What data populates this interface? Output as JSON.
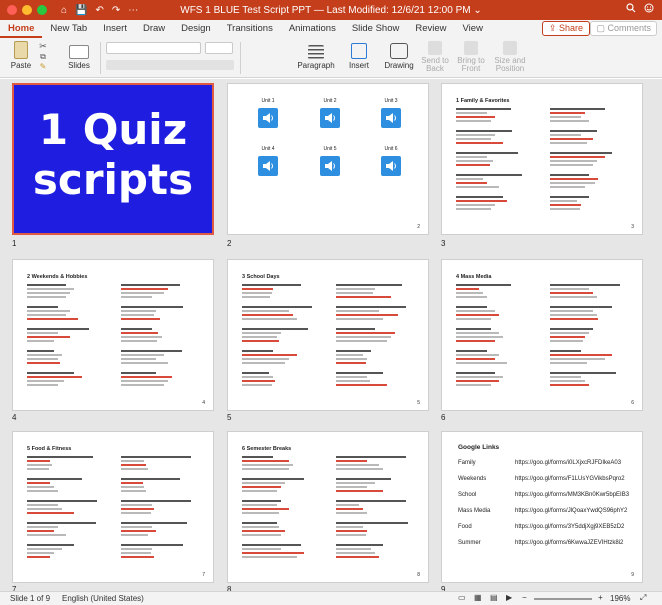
{
  "app": {
    "title": "WFS 1 BLUE Test Script PPT",
    "modified": "— Last Modified: 12/6/21 12:00 PM",
    "title_chevron": "⌄"
  },
  "quick_access": [
    "⌂",
    "💾",
    "↶",
    "↷",
    "⋯"
  ],
  "tabs": [
    {
      "label": "Home",
      "active": true
    },
    {
      "label": "New Tab"
    },
    {
      "label": "Insert"
    },
    {
      "label": "Draw"
    },
    {
      "label": "Design"
    },
    {
      "label": "Transitions"
    },
    {
      "label": "Animations"
    },
    {
      "label": "Slide Show"
    },
    {
      "label": "Review"
    },
    {
      "label": "View"
    }
  ],
  "share_label": "Share",
  "comments_label": "Comments",
  "ribbon": {
    "paste": "Paste",
    "slides": "Slides",
    "paragraph": "Paragraph",
    "insert": "Insert",
    "drawing": "Drawing",
    "send_to_back": "Send to Back",
    "bring_to_front": "Bring to Front",
    "size_position": "Size and Position"
  },
  "slides": [
    {
      "num": "1",
      "title": "1 Quiz scripts"
    },
    {
      "num": "2",
      "units": [
        "Unit 1",
        "Unit 2",
        "Unit 3",
        "Unit 4",
        "Unit 5",
        "Unit 6"
      ]
    },
    {
      "num": "3",
      "title": "1 Family & Favorites"
    },
    {
      "num": "4",
      "title": "2 Weekends & Hobbies"
    },
    {
      "num": "5",
      "title": "3 School Days"
    },
    {
      "num": "6",
      "title": "4 Mass Media"
    },
    {
      "num": "7",
      "title": "5 Food & Fitness"
    },
    {
      "num": "8",
      "title": "6 Semester Breaks"
    },
    {
      "num": "9",
      "title": "Google Links",
      "links": [
        {
          "k": "Family",
          "v": "https://goo.gl/forms/i0LXjxcRJFDIkeA03"
        },
        {
          "k": "Weekends",
          "v": "https://goo.gl/forms/F1LUsYGVikbsPqro2"
        },
        {
          "k": "School",
          "v": "https://goo.gl/forms/MM3KBn0Kwr5bpEIB3"
        },
        {
          "k": "Mass Media",
          "v": "https://goo.gl/forms/JlQoaxYwdQS96phY2"
        },
        {
          "k": "Food",
          "v": "https://goo.gl/forms/3Y5ddjXgj9XEB5zD2"
        },
        {
          "k": "Summer",
          "v": "https://goo.gl/forms/6KwwaJZEVIHtzk8i2"
        }
      ]
    }
  ],
  "status": {
    "slide_of": "Slide 1 of 9",
    "language": "English (United States)",
    "zoom": "196%"
  },
  "colors": {
    "accent": "#c43e1c",
    "slide1_bg": "#1f1ee0",
    "selection": "#e05a43"
  }
}
